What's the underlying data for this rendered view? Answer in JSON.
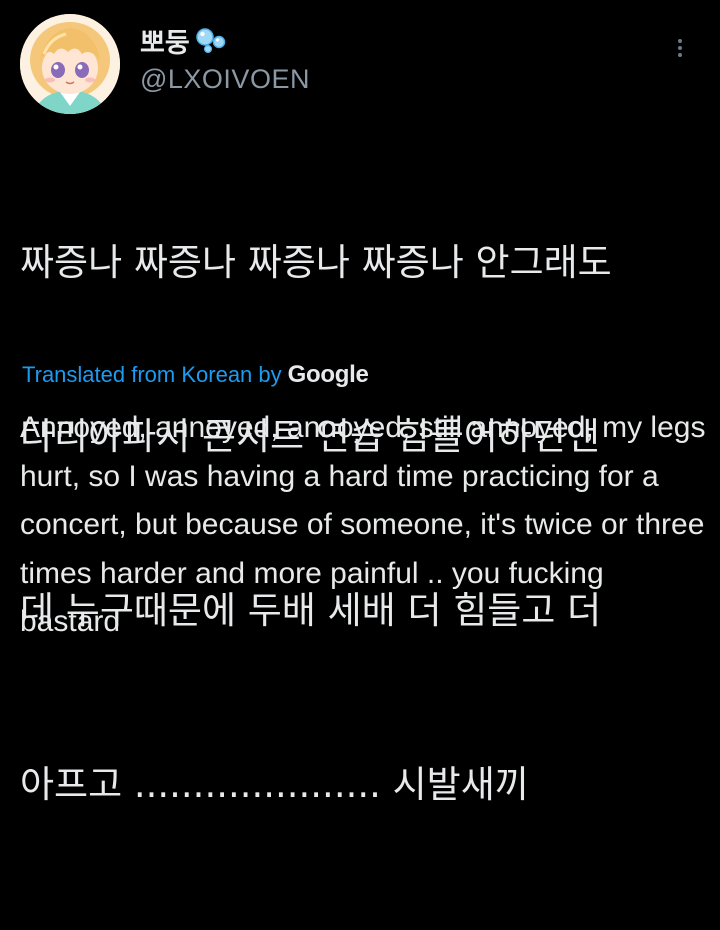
{
  "user": {
    "display_name": "뽀둥",
    "name_emoji_icon": "bubbles-icon",
    "handle": "@LXOIVOEN",
    "avatar_icon": "anime-avatar-icon"
  },
  "menu": {
    "icon": "more-vertical-icon"
  },
  "tweet": {
    "text_lines": [
      "짜증나 짜증나 짜증나 짜증나 안그래도",
      "다리아파서 콘서트 연습 힘들어하던앤",
      "데 누구때문에 두배 세배 더 힘들고 더",
      "아프고 ..................... 시발새끼"
    ]
  },
  "translation": {
    "label": "Translated from Korean by",
    "provider": "Google",
    "text": "Annoyed, annoyed, annoyed, still annoyed, my legs hurt, so I was having a hard time practicing for a concert, but because of someone, it's twice or three times harder and more painful .. you fucking bastard"
  },
  "colors": {
    "background": "#000000",
    "text": "#e7e9ea",
    "secondary": "#8b98a5",
    "link": "#1d9bf0"
  }
}
